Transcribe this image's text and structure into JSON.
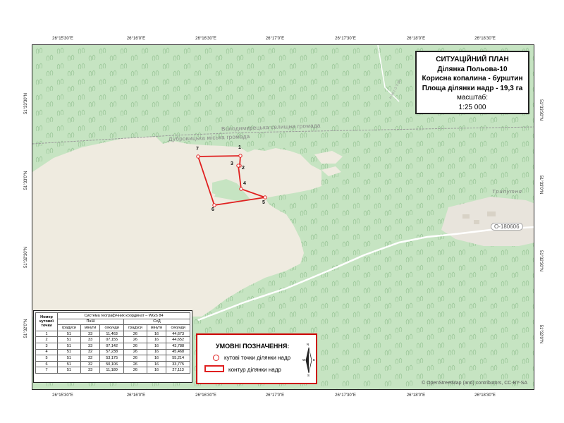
{
  "title_box": {
    "line1": "СИТУАЦІЙНИЙ ПЛАН",
    "line2": "Ділянка Польова-10",
    "line3": "Корисна копалина - бурштин",
    "line4": "Площа ділянки надр - 19,3 га",
    "scale_label": "масштаб:",
    "scale_value": "1:25 000"
  },
  "grid": {
    "top": [
      "26°15'30\"E",
      "26°16'0\"E",
      "26°16'30\"E",
      "26°17'0\"E",
      "26°17'30\"E",
      "26°18'0\"E",
      "26°18'30\"E"
    ],
    "bottom": [
      "26°15'30\"E",
      "26°16'0\"E",
      "26°16'30\"E",
      "26°17'0\"E",
      "26°17'30\"E",
      "26°18'0\"E",
      "26°18'30\"E"
    ],
    "left": [
      "51°33'30\"N",
      "51°33'0\"N",
      "51°32'30\"N",
      "51°32'0\"N"
    ],
    "right": [
      "51°33'30\"N",
      "51°33'0\"N",
      "51°32'30\"N",
      "51°32'0\"N"
    ]
  },
  "map_labels": {
    "hromada1": "Володимирецька селищна громада",
    "hromada2": "Дубровицька міська громада",
    "village": "Трипутня",
    "road": "О-180606",
    "road_side": "Н 90 г-3 Т-30",
    "attribution": "© OpenStreetMap (and) contributors, CC-BY-SA"
  },
  "points": [
    {
      "label": "1"
    },
    {
      "label": "2"
    },
    {
      "label": "3"
    },
    {
      "label": "4"
    },
    {
      "label": "5"
    },
    {
      "label": "6"
    },
    {
      "label": "7"
    }
  ],
  "legend": {
    "title": "УМОВНІ ПОЗНАЧЕННЯ:",
    "item_points": "кутові точки ділянки надр",
    "item_contour": "контур ділянки надр",
    "north_n": "N",
    "north_s": "S",
    "north_w": "W",
    "north_e": "E"
  },
  "table": {
    "col_number": "Номер кутової точки",
    "system": "Система географічних координат – WGS 84",
    "lat_head": "ПнШ",
    "lon_head": "СхД",
    "deg": "градуси",
    "min": "мінути",
    "sec": "секунди",
    "rows": [
      [
        "1",
        "51",
        "33",
        "11,463",
        "26",
        "16",
        "44,673"
      ],
      [
        "2",
        "51",
        "33",
        "07,155",
        "26",
        "16",
        "44,652"
      ],
      [
        "3",
        "51",
        "33",
        "07,142",
        "26",
        "16",
        "43,788"
      ],
      [
        "4",
        "51",
        "32",
        "57,238",
        "26",
        "16",
        "45,468"
      ],
      [
        "5",
        "51",
        "32",
        "53,175",
        "26",
        "16",
        "55,214"
      ],
      [
        "6",
        "51",
        "32",
        "50,106",
        "26",
        "16",
        "33,775"
      ],
      [
        "7",
        "51",
        "33",
        "11,180",
        "26",
        "16",
        "27,113"
      ]
    ]
  },
  "colors": {
    "forest": "#c6e4c2",
    "open": "#efebe0",
    "contour": "#e02020",
    "boundary": "#9a9a9a",
    "road": "#ffffff"
  }
}
